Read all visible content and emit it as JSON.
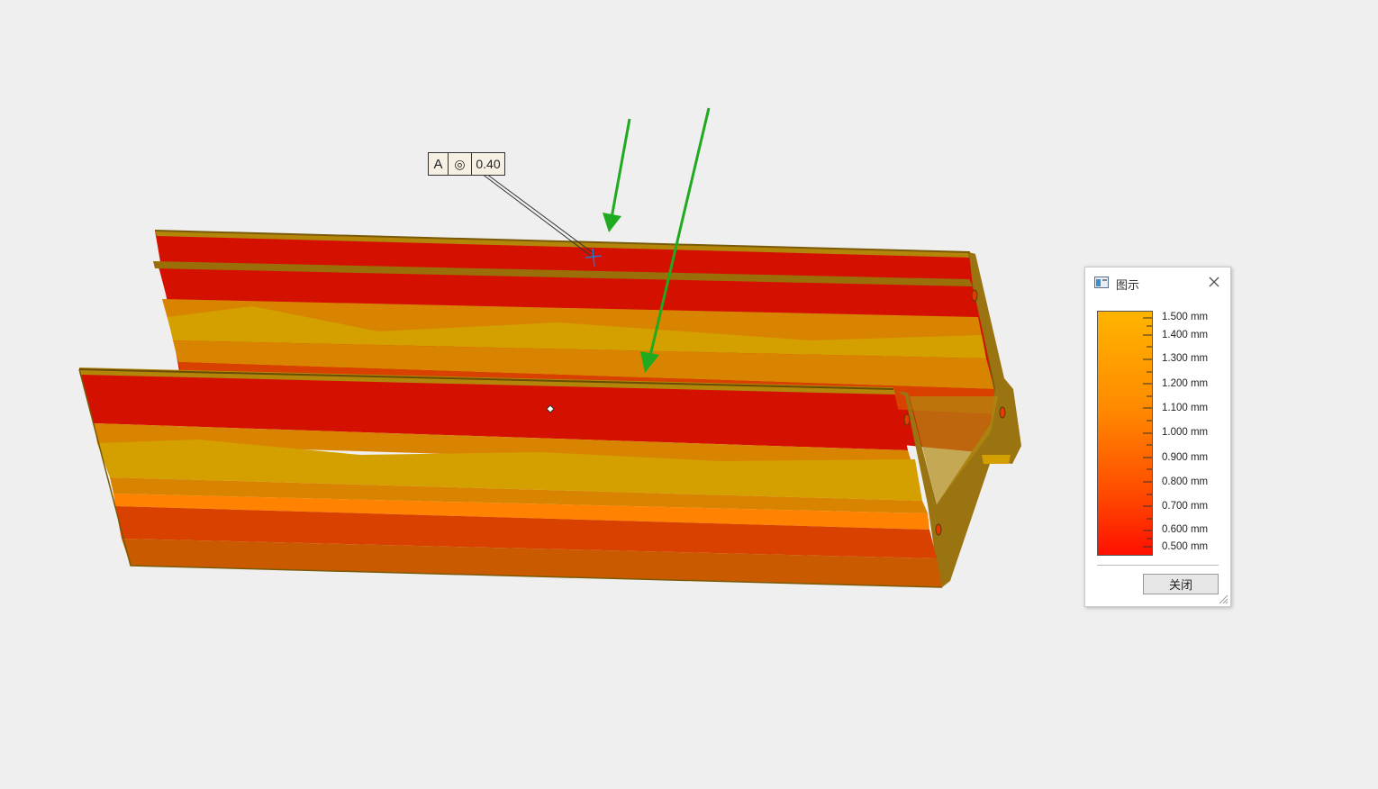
{
  "fcf": {
    "datum": "A",
    "symbol": "◎",
    "tolerance": "0.40"
  },
  "legend": {
    "title": "图示",
    "labels": [
      "1.500 mm",
      "1.400 mm",
      "1.300 mm",
      "1.200 mm",
      "1.100 mm",
      "1.000 mm",
      "0.900 mm",
      "0.800 mm",
      "0.700 mm",
      "0.600 mm",
      "0.500 mm"
    ],
    "close_button": "关闭",
    "colors": {
      "max": "#ffb400",
      "mid": "#ff8a00",
      "min": "#ff1000"
    }
  },
  "colors": {
    "viewport_bg": "#efefef",
    "red": "#d41100",
    "orange_red": "#d84100",
    "orange": "#d98400",
    "gold": "#d4a000",
    "edge": "#8c6a10",
    "arrow": "#1faa1f"
  }
}
